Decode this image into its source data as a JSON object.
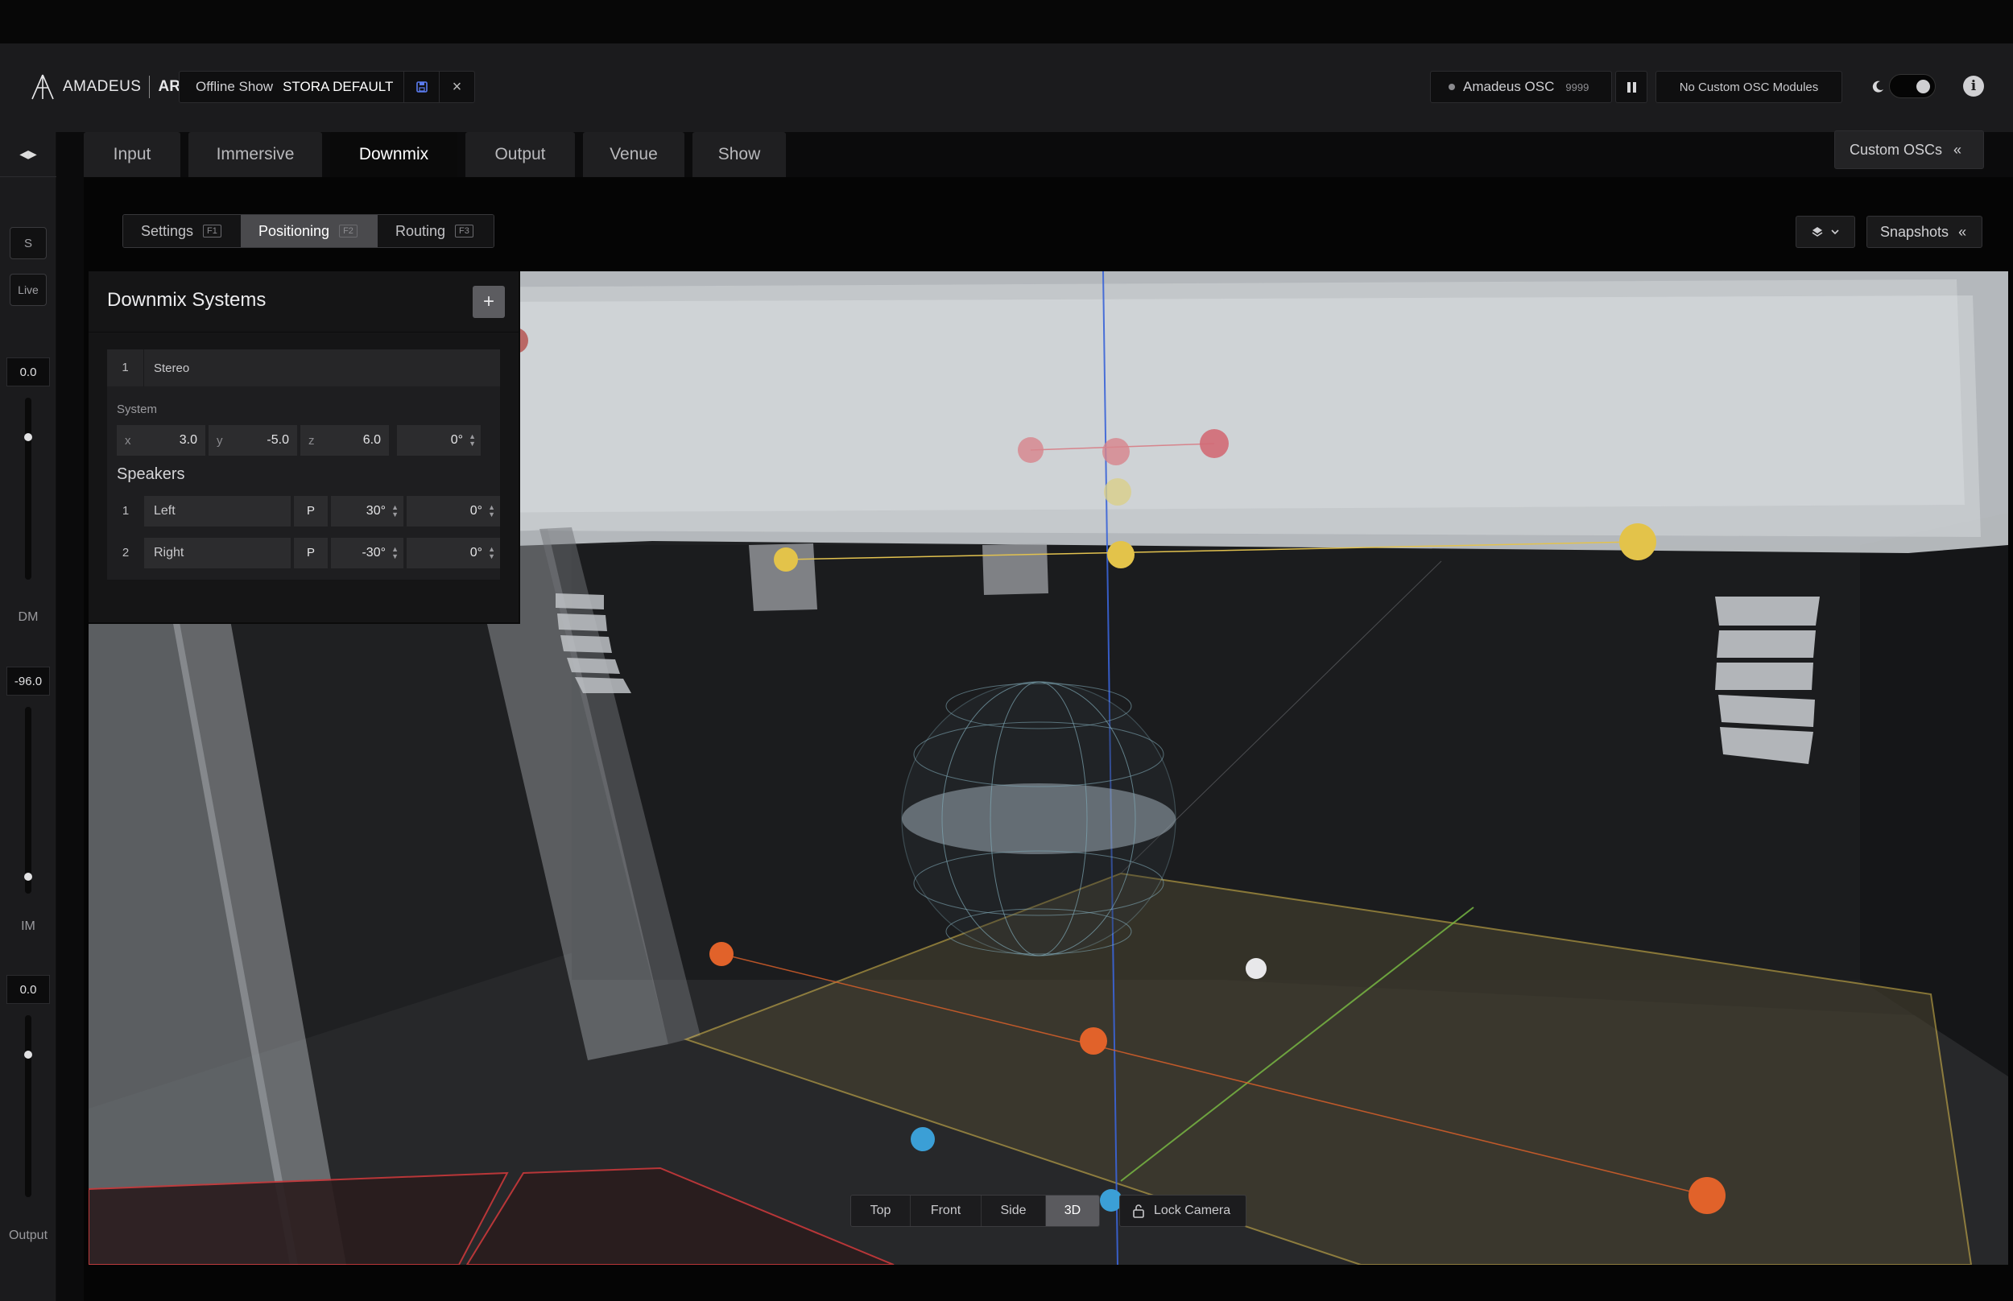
{
  "header": {
    "brand": "AMADEUS",
    "product": "ART",
    "show_label": "Offline Show",
    "show_name": "STORA DEFAULT",
    "osc_name": "Amadeus OSC",
    "osc_port": "9999",
    "osc_modules": "No Custom OSC Modules",
    "theme_mode": "dark"
  },
  "tabs": [
    {
      "label": "Input",
      "active": false
    },
    {
      "label": "Immersive",
      "active": false
    },
    {
      "label": "Downmix",
      "active": true
    },
    {
      "label": "Output",
      "active": false
    },
    {
      "label": "Venue",
      "active": false
    },
    {
      "label": "Show",
      "active": false
    }
  ],
  "custom_oscs_label": "Custom OSCs",
  "subtabs": [
    {
      "label": "Settings",
      "key": "F1",
      "active": false
    },
    {
      "label": "Positioning",
      "key": "F2",
      "active": true
    },
    {
      "label": "Routing",
      "key": "F3",
      "active": false
    }
  ],
  "snapshots_label": "Snapshots",
  "sidebar": {
    "solo_label": "S",
    "live_label": "Live",
    "dm_value": "0.0",
    "dm_label": "DM",
    "im_value": "-96.0",
    "im_label": "IM",
    "output_value": "0.0",
    "output_label": "Output"
  },
  "downmix": {
    "title": "Downmix Systems",
    "system": {
      "index": "1",
      "name": "Stereo",
      "section_label": "System",
      "x_label": "x",
      "x": "3.0",
      "y_label": "y",
      "y": "-5.0",
      "z_label": "z",
      "z": "6.0",
      "rotation": "0°"
    },
    "speakers_label": "Speakers",
    "speakers": [
      {
        "index": "1",
        "name": "Left",
        "mode": "P",
        "azimuth": "30°",
        "elevation": "0°"
      },
      {
        "index": "2",
        "name": "Right",
        "mode": "P",
        "azimuth": "-30°",
        "elevation": "0°"
      }
    ]
  },
  "view_modes": [
    {
      "label": "Top",
      "active": false
    },
    {
      "label": "Front",
      "active": false
    },
    {
      "label": "Side",
      "active": false
    },
    {
      "label": "3D",
      "active": true
    }
  ],
  "lock_camera_label": "Lock Camera",
  "colors": {
    "accent_yellow": "#e3c34a",
    "source_orange": "#e1622a",
    "source_blue": "#3b9fd6",
    "speaker_pink": "#d7848c",
    "stage_outline": "#e2c24f",
    "red_outline": "#c8383a"
  }
}
